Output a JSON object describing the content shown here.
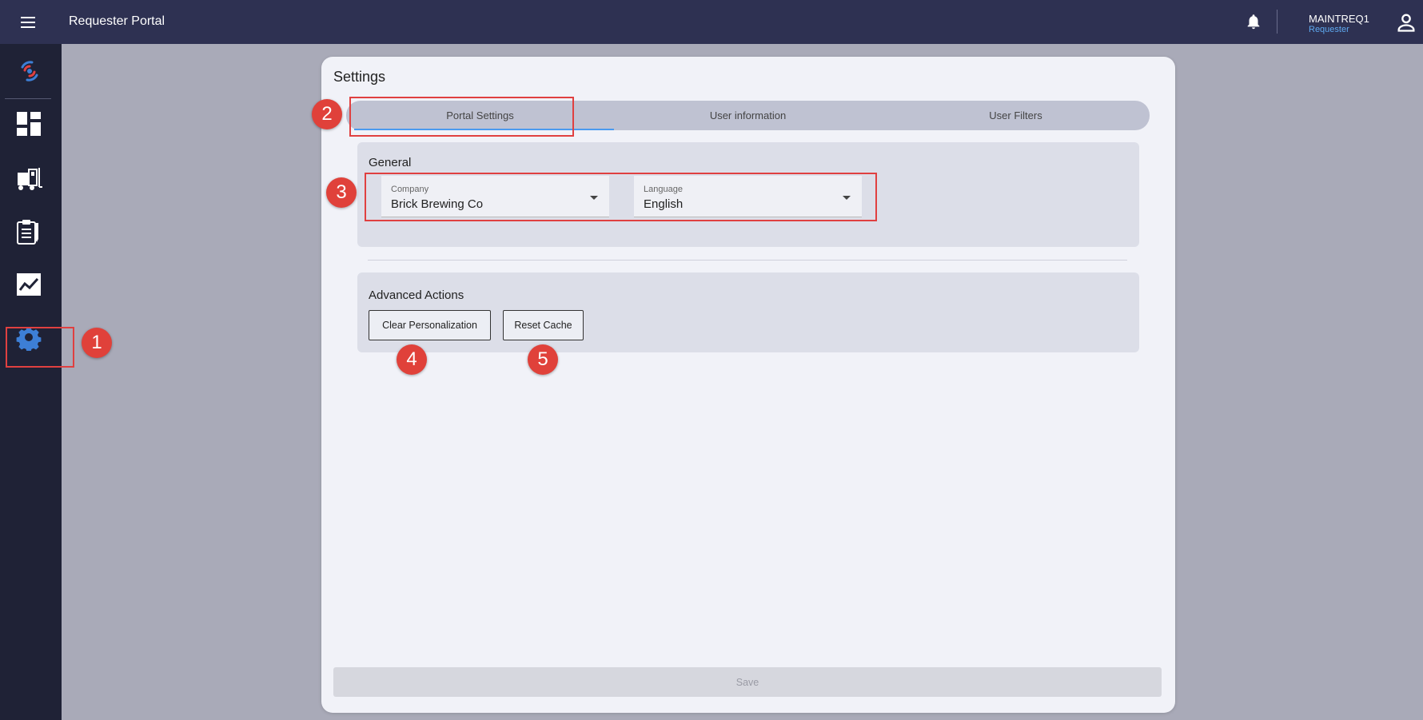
{
  "header": {
    "app_title": "Requester Portal",
    "user_name": "MAINTREQ1",
    "user_role": "Requester"
  },
  "sidebar": {
    "items": [
      {
        "name": "dashboard"
      },
      {
        "name": "assets"
      },
      {
        "name": "work-requests"
      },
      {
        "name": "reports"
      },
      {
        "name": "settings"
      }
    ],
    "accent": "#3d7fd6"
  },
  "settings": {
    "title": "Settings",
    "tabs": [
      {
        "label": "Portal Settings",
        "active": true
      },
      {
        "label": "User information",
        "active": false
      },
      {
        "label": "User Filters",
        "active": false
      }
    ],
    "general": {
      "title": "General",
      "company": {
        "label": "Company",
        "value": "Brick Brewing Co"
      },
      "language": {
        "label": "Language",
        "value": "English"
      }
    },
    "advanced": {
      "title": "Advanced Actions",
      "clear_label": "Clear Personalization",
      "reset_label": "Reset Cache"
    },
    "save_label": "Save"
  },
  "callouts": [
    "1",
    "2",
    "3",
    "4",
    "5"
  ],
  "colors": {
    "topbar": "#2e3152",
    "sidebar": "#1f2236",
    "callout": "#e0413a",
    "tab_indicator": "#4a9af0"
  }
}
